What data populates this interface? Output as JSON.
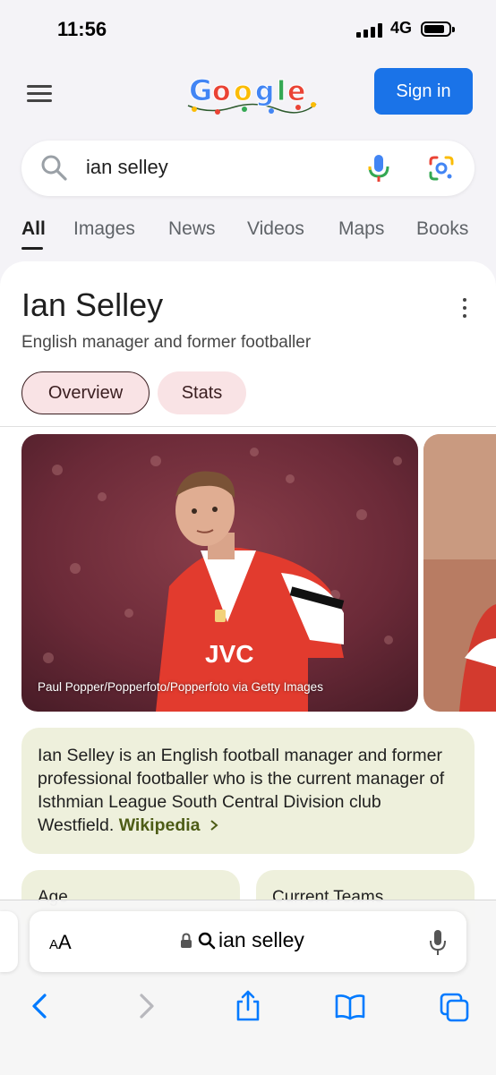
{
  "status_bar": {
    "time": "11:56",
    "network": "4G"
  },
  "header": {
    "sign_in_label": "Sign in",
    "logo_text": "Google"
  },
  "search": {
    "query": "ian selley"
  },
  "tabs": [
    {
      "label": "All",
      "active": true
    },
    {
      "label": "Images"
    },
    {
      "label": "News"
    },
    {
      "label": "Videos"
    },
    {
      "label": "Maps"
    },
    {
      "label": "Books"
    }
  ],
  "knowledge_panel": {
    "title": "Ian Selley",
    "subtitle": "English manager and former footballer",
    "chips": [
      "Overview",
      "Stats"
    ],
    "photo_credit": "Paul Popper/Popperfoto/Popperfoto via Getty Images",
    "description": "Ian Selley is an English football manager and former professional footballer who is the current manager of Isthmian League South Central Division club Westfield.",
    "source_link": "Wikipedia",
    "stats": [
      {
        "label": "Age"
      },
      {
        "label": "Current Teams"
      }
    ]
  },
  "safari": {
    "text_size_label_big": "A",
    "text_size_label_small": "A",
    "url": "ian selley"
  },
  "colors": {
    "accent": "#1a73e8",
    "chip_bg": "#f9e3e5",
    "desc_bg": "#eef0dc",
    "link": "#4d5c16",
    "ios_blue": "#007aff"
  }
}
